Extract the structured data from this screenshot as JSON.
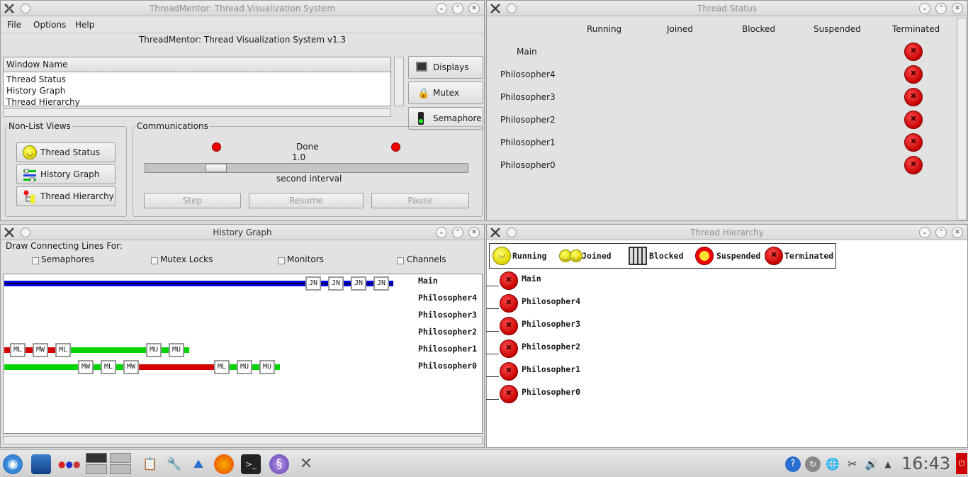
{
  "main_window": {
    "title": "ThreadMentor: Thread Visualization System",
    "menu": [
      "File",
      "Options",
      "Help"
    ],
    "heading": "ThreadMentor: Thread Visualization System v1.3",
    "list_header": "Window Name",
    "list_items": [
      "Thread Status",
      "History Graph",
      "Thread Hierarchy"
    ],
    "side_buttons": [
      "Displays",
      "Mutex",
      "Semaphore"
    ],
    "nonlist_label": "Non-List Views",
    "nonlist_buttons": [
      "Thread Status",
      "History Graph",
      "Thread Hierarchy"
    ],
    "comm_label": "Communications",
    "status": "Done",
    "interval_value": "1.0",
    "interval_label": "second interval",
    "slider_fraction": 0.2,
    "control_buttons": [
      "Step",
      "Resume",
      "Pause"
    ]
  },
  "thread_status": {
    "title": "Thread Status",
    "columns": [
      "Running",
      "Joined",
      "Blocked",
      "Suspended",
      "Terminated"
    ],
    "threads": [
      "Main",
      "Philosopher4",
      "Philosopher3",
      "Philosopher2",
      "Philosopher1",
      "Philosopher0"
    ]
  },
  "history_graph": {
    "title": "History Graph",
    "draw_label": "Draw Connecting Lines For:",
    "options": [
      "Semaphores",
      "Mutex Locks",
      "Monitors",
      "Channels"
    ],
    "threads": [
      "Main",
      "Philosopher4",
      "Philosopher3",
      "Philosopher2",
      "Philosopher1",
      "Philosopher0"
    ],
    "main_events": [
      "JN",
      "JN",
      "JN",
      "JN"
    ],
    "philosopher1_events": [
      "ML",
      "MW",
      "ML",
      "MU",
      "MU"
    ],
    "philosopher0_events": [
      "MW",
      "ML",
      "MW",
      "ML",
      "MU",
      "MU"
    ]
  },
  "thread_hierarchy": {
    "title": "Thread Hierarchy",
    "legend": [
      "Running",
      "Joined",
      "Blocked",
      "Suspended",
      "Terminated"
    ],
    "threads": [
      "Main",
      "Philosopher4",
      "Philosopher3",
      "Philosopher2",
      "Philosopher1",
      "Philosopher0"
    ]
  },
  "taskbar": {
    "clock": "16:43"
  },
  "colors": {
    "thread_blue": "#0000e0",
    "thread_red": "#d40000",
    "thread_green": "#00d400",
    "terminated_red": "#d00000"
  }
}
